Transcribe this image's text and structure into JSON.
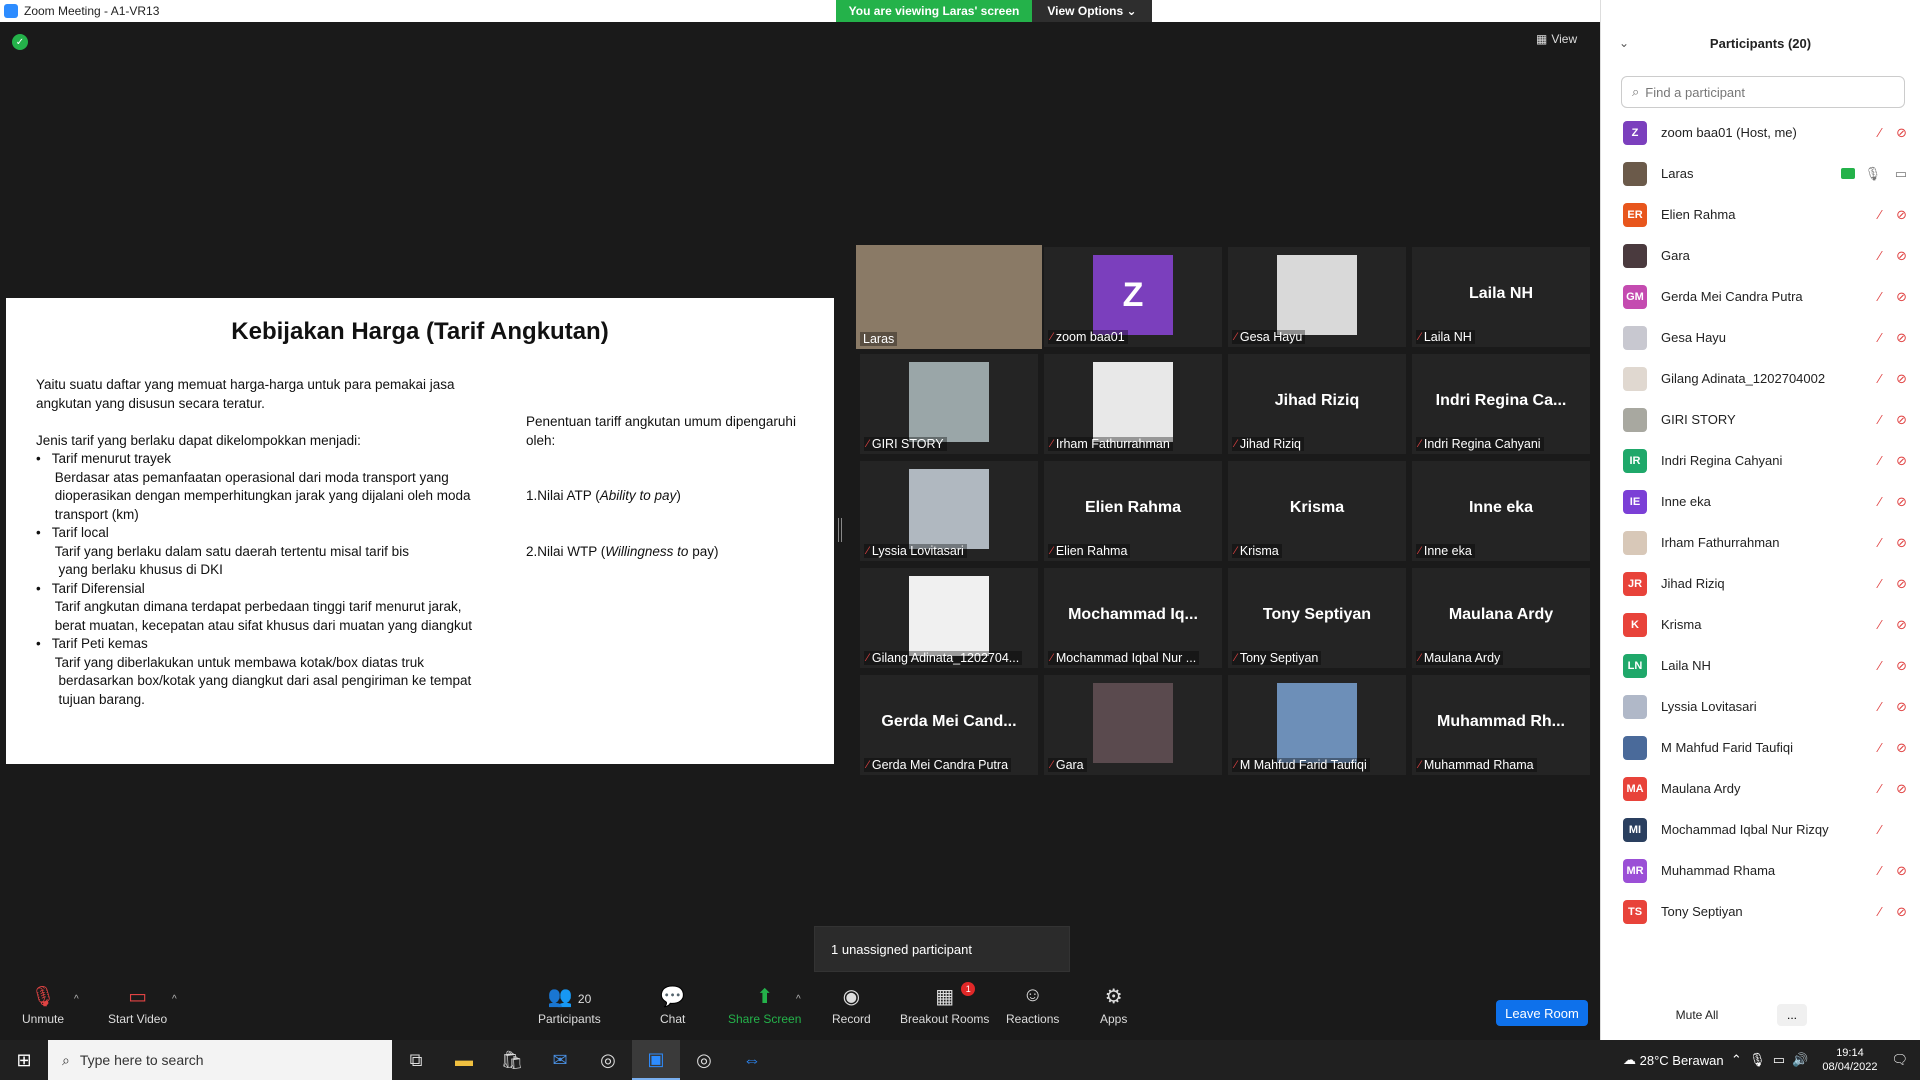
{
  "window": {
    "title": "Zoom Meeting - A1-VR13",
    "viewing_banner": "You are viewing Laras' screen",
    "view_options": "View Options",
    "view_button": "View"
  },
  "slide": {
    "title": "Kebijakan Harga (Tarif Angkutan)",
    "left_text": "Yaitu suatu daftar yang memuat harga-harga untuk para pemakai jasa\nangkutan yang disusun secara teratur.\n\nJenis tarif yang berlaku dapat dikelompokkan menjadi:\n•   Tarif menurut trayek\n     Berdasar atas pemanfaatan operasional dari moda transport yang\n     dioperasikan dengan memperhitungkan jarak yang dijalani oleh moda\n     transport (km)\n•   Tarif local\n     Tarif yang berlaku dalam satu daerah tertentu misal tarif bis\n      yang berlaku khusus di DKI\n•   Tarif Diferensial\n     Tarif angkutan dimana terdapat perbedaan tinggi tarif menurut jarak,\n     berat muatan, kecepatan atau sifat khusus dari muatan yang diangkut\n•   Tarif Peti kemas\n     Tarif yang diberlakukan untuk membawa kotak/box diatas truk\n      berdasarkan box/kotak yang diangkut dari asal pengiriman ke tempat\n      tujuan barang.",
    "right_intro": "Penentuan tariff angkutan umum dipengaruhi\noleh:",
    "right_item1_prefix": "1.Nilai ATP (",
    "right_item1_italic": "Ability to pay",
    "right_item1_suffix": ")",
    "right_item2_prefix": "2.Nilai WTP (",
    "right_item2_italic": "Willingness to",
    "right_item2_suffix": " pay)"
  },
  "tiles": [
    {
      "label": "Laras",
      "big": "",
      "type": "photo",
      "color": "#8a7a66",
      "muted": false,
      "active": true
    },
    {
      "label": "zoom baa01",
      "big": "Z",
      "type": "letter",
      "color": "#7b3fbd",
      "muted": true,
      "active": false
    },
    {
      "label": "Gesa Hayu",
      "big": "",
      "type": "photo",
      "color": "#d9d9d9",
      "muted": true,
      "active": false
    },
    {
      "label": "Laila NH",
      "big": "Laila NH",
      "type": "name",
      "color": "",
      "muted": true,
      "active": false
    },
    {
      "label": "GIRI STORY",
      "big": "",
      "type": "photo",
      "color": "#9aa6a8",
      "muted": true,
      "active": false
    },
    {
      "label": "Irham Fathurrahman",
      "big": "",
      "type": "photo",
      "color": "#e8e8e8",
      "muted": true,
      "active": false
    },
    {
      "label": "Jihad Riziq",
      "big": "Jihad Riziq",
      "type": "name",
      "color": "",
      "muted": true,
      "active": false
    },
    {
      "label": "Indri Regina Cahyani",
      "big": "Indri  Regina  Ca...",
      "type": "name",
      "color": "",
      "muted": true,
      "active": false
    },
    {
      "label": "Lyssia Lovitasari",
      "big": "",
      "type": "photo",
      "color": "#b0b8c0",
      "muted": true,
      "active": false
    },
    {
      "label": "Elien Rahma",
      "big": "Elien Rahma",
      "type": "name",
      "color": "",
      "muted": true,
      "active": false
    },
    {
      "label": "Krisma",
      "big": "Krisma",
      "type": "name",
      "color": "",
      "muted": true,
      "active": false
    },
    {
      "label": "Inne eka",
      "big": "Inne eka",
      "type": "name",
      "color": "",
      "muted": true,
      "active": false
    },
    {
      "label": "Gilang Adinata_1202704...",
      "big": "",
      "type": "photo",
      "color": "#f0f0f0",
      "muted": true,
      "active": false
    },
    {
      "label": "Mochammad Iqbal Nur ...",
      "big": "Mochammad  Iq...",
      "type": "name",
      "color": "",
      "muted": true,
      "active": false
    },
    {
      "label": "Tony Septiyan",
      "big": "Tony Septiyan",
      "type": "name",
      "color": "",
      "muted": true,
      "active": false
    },
    {
      "label": "Maulana Ardy",
      "big": "Maulana Ardy",
      "type": "name",
      "color": "",
      "muted": true,
      "active": false
    },
    {
      "label": "Gerda Mei Candra Putra",
      "big": "Gerda  Mei  Cand...",
      "type": "name",
      "color": "",
      "muted": true,
      "active": false
    },
    {
      "label": "Gara",
      "big": "",
      "type": "photo",
      "color": "#5a4a4e",
      "muted": true,
      "active": false
    },
    {
      "label": "M Mahfud Farid Taufiqi",
      "big": "",
      "type": "photo",
      "color": "#6d8fb8",
      "muted": true,
      "active": false
    },
    {
      "label": "Muhammad Rhama",
      "big": "Muhammad  Rh...",
      "type": "name",
      "color": "",
      "muted": true,
      "active": false
    }
  ],
  "toast": "1 unassigned participant",
  "toolbar": {
    "unmute": "Unmute",
    "start_video": "Start Video",
    "participants": "Participants",
    "participants_count": "20",
    "chat": "Chat",
    "share_screen": "Share Screen",
    "record": "Record",
    "breakout_rooms": "Breakout Rooms",
    "breakout_badge": "1",
    "reactions": "Reactions",
    "apps": "Apps",
    "leave": "Leave Room"
  },
  "panel": {
    "title": "Participants (20)",
    "search_placeholder": "Find a participant",
    "mute_all": "Mute All",
    "more": "...",
    "participants": [
      {
        "name": "zoom baa01 (Host, me)",
        "initials": "Z",
        "color": "#7b3fbd",
        "mic": "off",
        "cam": "off",
        "share": false
      },
      {
        "name": "Laras",
        "initials": "",
        "color": "#6b5a4a",
        "mic": "on",
        "cam": "on",
        "share": true
      },
      {
        "name": "Elien Rahma",
        "initials": "ER",
        "color": "#e8561c",
        "mic": "off",
        "cam": "off",
        "share": false
      },
      {
        "name": "Gara",
        "initials": "",
        "color": "#4a3a3e",
        "mic": "off",
        "cam": "off",
        "share": false
      },
      {
        "name": "Gerda Mei Candra Putra",
        "initials": "GM",
        "color": "#c44bb0",
        "mic": "off",
        "cam": "off",
        "share": false
      },
      {
        "name": "Gesa Hayu",
        "initials": "",
        "color": "#c8c8d0",
        "mic": "off",
        "cam": "off",
        "share": false
      },
      {
        "name": "Gilang Adinata_1202704002",
        "initials": "",
        "color": "#e0d8d0",
        "mic": "off",
        "cam": "off",
        "share": false
      },
      {
        "name": "GIRI STORY",
        "initials": "",
        "color": "#a8a8a0",
        "mic": "off",
        "cam": "off",
        "share": false
      },
      {
        "name": "Indri Regina Cahyani",
        "initials": "IR",
        "color": "#1fa86a",
        "mic": "off",
        "cam": "off",
        "share": false
      },
      {
        "name": "Inne eka",
        "initials": "IE",
        "color": "#7b3fd6",
        "mic": "off",
        "cam": "off",
        "share": false
      },
      {
        "name": "Irham Fathurrahman",
        "initials": "",
        "color": "#d8c8b8",
        "mic": "off",
        "cam": "off",
        "share": false
      },
      {
        "name": "Jihad Riziq",
        "initials": "JR",
        "color": "#e8433a",
        "mic": "off",
        "cam": "off",
        "share": false
      },
      {
        "name": "Krisma",
        "initials": "K",
        "color": "#e8433a",
        "mic": "off",
        "cam": "off",
        "share": false
      },
      {
        "name": "Laila NH",
        "initials": "LN",
        "color": "#1fa86a",
        "mic": "off",
        "cam": "off",
        "share": false
      },
      {
        "name": "Lyssia Lovitasari",
        "initials": "",
        "color": "#b0b8c8",
        "mic": "off",
        "cam": "off",
        "share": false
      },
      {
        "name": "M Mahfud Farid Taufiqi",
        "initials": "",
        "color": "#4a6a9a",
        "mic": "off",
        "cam": "off",
        "share": false
      },
      {
        "name": "Maulana Ardy",
        "initials": "MA",
        "color": "#e8433a",
        "mic": "off",
        "cam": "off",
        "share": false
      },
      {
        "name": "Mochammad Iqbal Nur Rizqy",
        "initials": "MI",
        "color": "#2a3f5f",
        "mic": "off",
        "cam": "none",
        "share": false
      },
      {
        "name": "Muhammad Rhama",
        "initials": "MR",
        "color": "#9b4fd6",
        "mic": "off",
        "cam": "off",
        "share": false
      },
      {
        "name": "Tony Septiyan",
        "initials": "TS",
        "color": "#e8433a",
        "mic": "off",
        "cam": "off",
        "share": false
      }
    ]
  },
  "taskbar": {
    "search_placeholder": "Type here to search",
    "weather": "28°C  Berawan",
    "time": "19:14",
    "date": "08/04/2022"
  }
}
